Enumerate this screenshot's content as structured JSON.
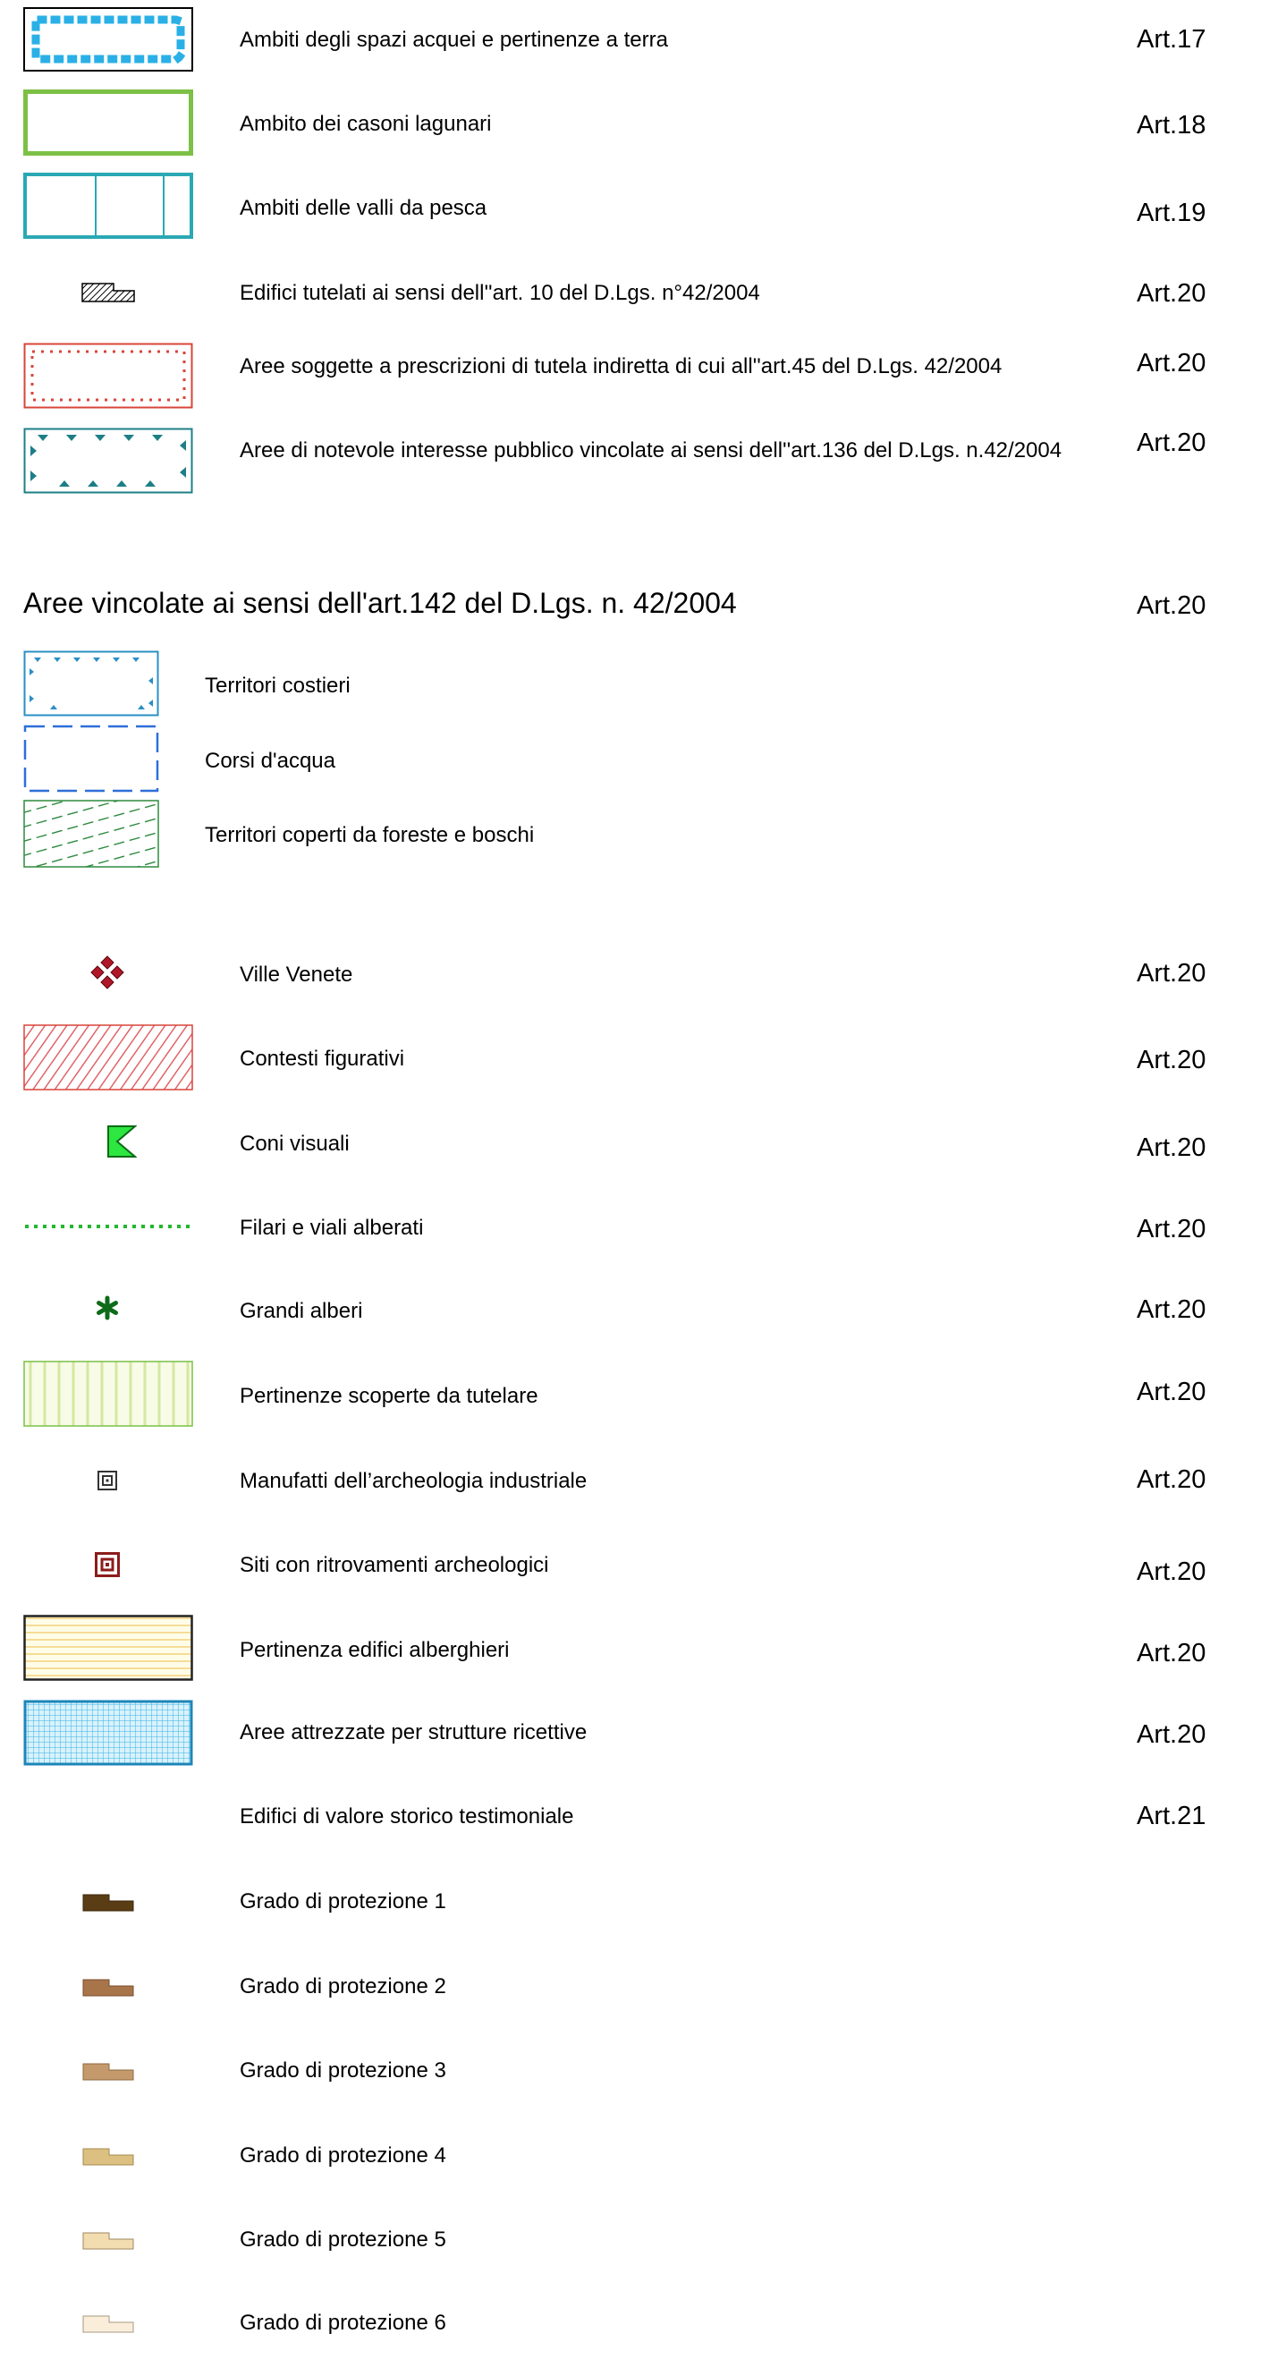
{
  "upper_items": [
    {
      "symbol": "dotted-diamond-blue-box-icon",
      "label": "Ambiti degli spazi acquei e pertinenze a terra",
      "article": "Art.17"
    },
    {
      "symbol": "green-outline-box-icon",
      "label": "Ambito dei casoni lagunari",
      "article": "Art.18"
    },
    {
      "symbol": "teal-divided-box-icon",
      "label": "Ambiti delle valli da pesca",
      "article": "Art.19"
    },
    {
      "symbol": "hatched-building-icon",
      "label": "Edifici  tutelati ai sensi dell''art. 10 del D.Lgs. n°42/2004",
      "article": "Art.20"
    },
    {
      "symbol": "red-dotted-box-icon",
      "label": "Aree soggette a prescrizioni di tutela indiretta di cui all''art.45 del D.Lgs. 42/2004",
      "article": "Art.20"
    },
    {
      "symbol": "teal-triangle-box-icon",
      "label": "Aree di notevole interesse pubblico vincolate ai sensi dell''art.136 del D.Lgs. n.42/2004",
      "article": "Art.20"
    }
  ],
  "section": {
    "heading": "Aree vincolate ai sensi dell'art.142 del D.Lgs. n. 42/2004",
    "article": "Art.20",
    "items": [
      {
        "symbol": "blue-triangle-box-icon",
        "label": "Territori costieri"
      },
      {
        "symbol": "blue-dashed-box-icon",
        "label": "Corsi d'acqua"
      },
      {
        "symbol": "green-diagonal-dash-box-icon",
        "label": "Territori coperti da foreste e boschi"
      }
    ]
  },
  "lower_items": [
    {
      "symbol": "red-diamond-cluster-icon",
      "label": "Ville Venete",
      "article": "Art.20"
    },
    {
      "symbol": "red-hatched-box-icon",
      "label": "Contesti figurativi",
      "article": "Art.20"
    },
    {
      "symbol": "green-flag-icon",
      "label": "Coni visuali",
      "article": "Art.20"
    },
    {
      "symbol": "green-dotted-line-icon",
      "label": "Filari e viali alberati",
      "article": "Art.20"
    },
    {
      "symbol": "green-asterisk-icon",
      "label": "Grandi alberi",
      "article": "Art.20"
    },
    {
      "symbol": "green-vertical-line-box-icon",
      "label": "Pertinenze scoperte da tutelare",
      "article": "Art.20"
    },
    {
      "symbol": "grey-square-target-icon",
      "label": "Manufatti dell’archeologia industriale",
      "article": "Art.20"
    },
    {
      "symbol": "red-square-target-icon",
      "label": "Siti con ritrovamenti archeologici",
      "article": "Art.20"
    },
    {
      "symbol": "yellow-striped-box-icon",
      "label": "Pertinenza edifici alberghieri",
      "article": "Art.20"
    },
    {
      "symbol": "blue-grid-box-icon",
      "label": "Aree attrezzate per strutture ricettive",
      "article": "Art.20"
    },
    {
      "symbol": "",
      "label": "Edifici di valore storico testimoniale",
      "article": "Art.21"
    }
  ],
  "grades": [
    {
      "label": "Grado di protezione 1",
      "color": "#5a3d14"
    },
    {
      "label": "Grado di protezione 2",
      "color": "#a8744a"
    },
    {
      "label": "Grado di protezione 3",
      "color": "#c49a6c"
    },
    {
      "label": "Grado di protezione 4",
      "color": "#dcc081"
    },
    {
      "label": "Grado di protezione 5",
      "color": "#f2ddb0"
    },
    {
      "label": "Grado di protezione 6",
      "color": "#faeedb"
    }
  ]
}
